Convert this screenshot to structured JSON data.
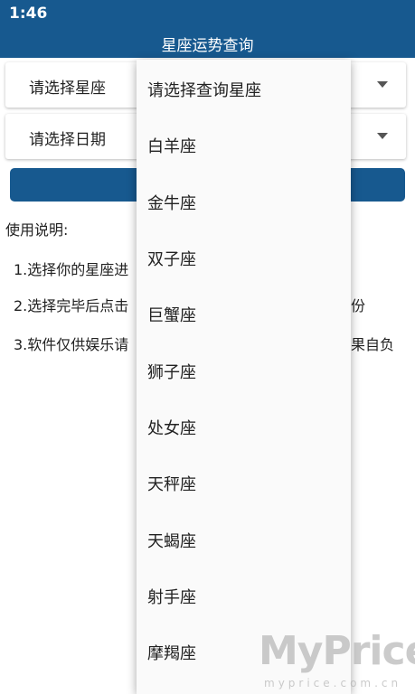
{
  "status_bar": {
    "time": "1:46"
  },
  "header": {
    "title": "星座运势查询"
  },
  "selects": {
    "zodiac_placeholder": "请选择星座",
    "date_placeholder": "请选择日期"
  },
  "query_button": {
    "label": ""
  },
  "instructions": {
    "title": "使用说明:",
    "items": [
      {
        "visible_start": "1.选择你的星座进",
        "visible_end": ""
      },
      {
        "visible_start": "2.选择完毕后点击",
        "visible_end": "份"
      },
      {
        "visible_start": "3.软件仅供娱乐请",
        "visible_end": "果自负"
      }
    ]
  },
  "dropdown": {
    "options": [
      "请选择查询星座",
      "白羊座",
      "金牛座",
      "双子座",
      "巨蟹座",
      "狮子座",
      "处女座",
      "天秤座",
      "天蝎座",
      "射手座",
      "摩羯座"
    ]
  },
  "watermark": {
    "main": "MyPrice",
    "sub": "myprice.com.cn"
  },
  "colors": {
    "primary": "#17598f",
    "background": "#ffffff",
    "dropdown_bg": "#fafafa"
  }
}
